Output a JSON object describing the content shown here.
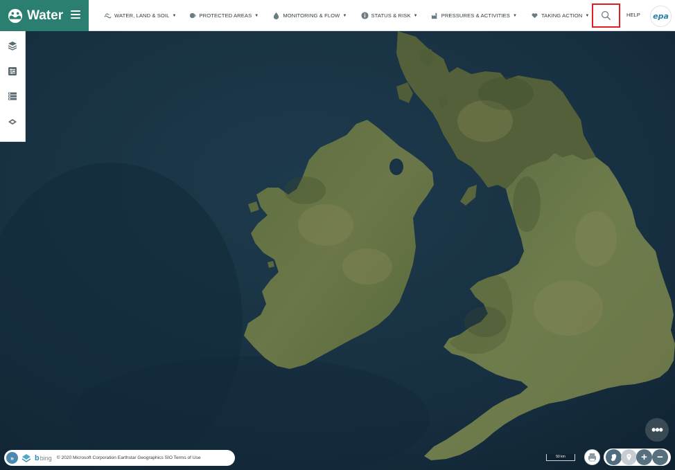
{
  "app": {
    "title": "Water",
    "brand_color": "#2b7f70"
  },
  "nav": {
    "items": [
      {
        "label": "WATER, LAND & SOIL",
        "icon": "land-soil-icon"
      },
      {
        "label": "PROTECTED AREAS",
        "icon": "protected-areas-icon"
      },
      {
        "label": "MONITORING & FLOW",
        "icon": "water-drop-icon"
      },
      {
        "label": "STATUS & RISK",
        "icon": "info-icon"
      },
      {
        "label": "PRESSURES & ACTIVITIES",
        "icon": "factory-icon"
      },
      {
        "label": "TAKING ACTION",
        "icon": "heart-hand-icon"
      }
    ],
    "help_label": "HELP",
    "logo_text": "epa",
    "highlight_color": "#e01f25"
  },
  "tools": [
    {
      "icon": "layers-icon"
    },
    {
      "icon": "filter-icon"
    },
    {
      "icon": "legend-icon"
    },
    {
      "icon": "basemap-icon"
    }
  ],
  "footer": {
    "expand_label": "»",
    "bing_label": "bing",
    "attribution": "© 2020 Microsoft Corporation Earthstar Geographics SIO Terms of Use",
    "scale_label": "50 km",
    "zoom_in_label": "+",
    "zoom_out_label": "−",
    "more_label": "•••"
  }
}
